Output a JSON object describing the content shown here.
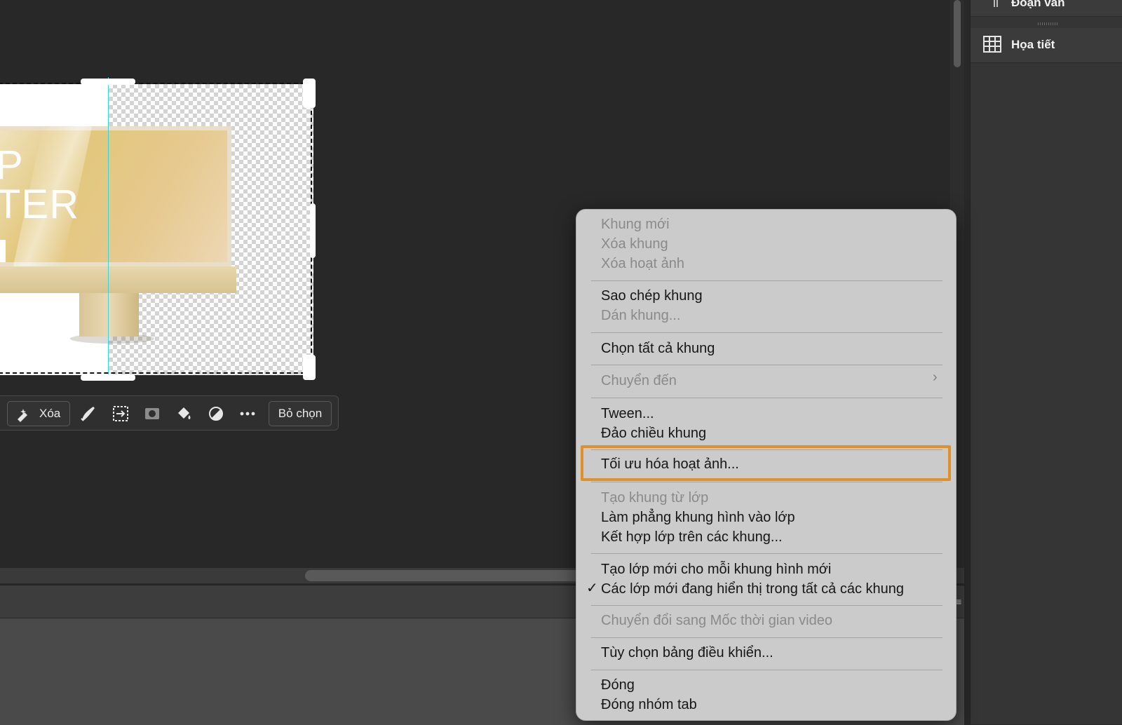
{
  "canvas": {
    "artwork_text": "P\nTER"
  },
  "taskbar": {
    "erase_label": "Xóa",
    "deselect_label": "Bỏ chọn",
    "icons": [
      "erase-icon",
      "brush-icon",
      "transform-icon",
      "mask-icon",
      "fill-icon",
      "adjustment-icon",
      "more-icon"
    ]
  },
  "right_panel": {
    "items": [
      {
        "label": "Đoạn văn",
        "icon": "paragraph-icon"
      },
      {
        "label": "Họa tiết",
        "icon": "pattern-icon"
      }
    ]
  },
  "context_menu": {
    "items": [
      {
        "label": "Khung mới",
        "enabled": false
      },
      {
        "label": "Xóa khung",
        "enabled": false
      },
      {
        "label": "Xóa hoạt ảnh",
        "enabled": false
      },
      {
        "label": "Sao chép khung",
        "enabled": true
      },
      {
        "label": "Dán khung...",
        "enabled": false
      },
      {
        "label": "Chọn tất cả khung",
        "enabled": true
      },
      {
        "label": "Chuyển đến",
        "enabled": false,
        "submenu": true
      },
      {
        "label": "Tween...",
        "enabled": true
      },
      {
        "label": "Đảo chiều khung",
        "enabled": true
      },
      {
        "label": "Tối ưu hóa hoạt ảnh...",
        "enabled": true,
        "highlighted": true
      },
      {
        "label": "Tạo khung từ lớp",
        "enabled": false
      },
      {
        "label": "Làm phẳng khung hình vào lớp",
        "enabled": true
      },
      {
        "label": "Kết hợp lớp trên các khung...",
        "enabled": true
      },
      {
        "label": "Tạo lớp mới cho mỗi khung hình mới",
        "enabled": true
      },
      {
        "label": "Các lớp mới đang hiển thị trong tất cả các khung",
        "enabled": true,
        "checked": true
      },
      {
        "label": "Chuyển đổi sang Mốc thời gian video",
        "enabled": false
      },
      {
        "label": "Tùy chọn bảng điều khiển...",
        "enabled": true
      },
      {
        "label": "Đóng",
        "enabled": true
      },
      {
        "label": "Đóng nhóm tab",
        "enabled": true
      }
    ],
    "highlight_color": "#e0912a"
  },
  "colors": {
    "workspace": "#282828",
    "guide": "#3ad3d9",
    "menu_bg": "#cbcbcb"
  }
}
